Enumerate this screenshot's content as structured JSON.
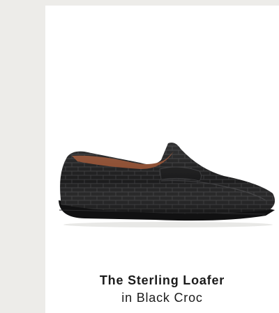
{
  "product": {
    "name": "The Sterling Loafer",
    "variant": "in Black Croc",
    "image": "black-croc-penny-loafer-image"
  },
  "colors": {
    "page_background": "#edece9",
    "card_background": "#ffffff",
    "shoe_black": "#1c1c1d",
    "lining_brown": "#8a4a2e",
    "text": "#1b1b1b"
  }
}
